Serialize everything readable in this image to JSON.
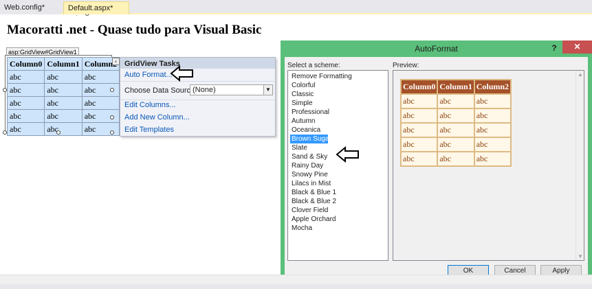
{
  "tabs": [
    {
      "label": "Web.config*"
    },
    {
      "label": "Default.aspx*",
      "pin_icon": "pin-icon",
      "close_icon": "close-icon"
    }
  ],
  "page": {
    "title": "Macoratti .net - Quase tudo para Visual Basic"
  },
  "gridview": {
    "tag": "asp:GridView#GridView1",
    "columns": [
      "Column0",
      "Column1",
      "Column2"
    ],
    "rows": [
      [
        "abc",
        "abc",
        "abc"
      ],
      [
        "abc",
        "abc",
        "abc"
      ],
      [
        "abc",
        "abc",
        "abc"
      ],
      [
        "abc",
        "abc",
        "abc"
      ],
      [
        "abc",
        "abc",
        "abc"
      ]
    ],
    "smart_tag_glyph": "‹"
  },
  "tasks": {
    "title": "GridView Tasks",
    "auto_format": "Auto Format...",
    "data_source_label": "Choose Data Source:",
    "data_source_value": "(None)",
    "edit_columns": "Edit Columns...",
    "add_column": "Add New Column...",
    "edit_templates": "Edit Templates"
  },
  "dialog": {
    "title": "AutoFormat",
    "help": "?",
    "close": "✕",
    "scheme_label": "Select a scheme:",
    "preview_label": "Preview:",
    "selected_scheme": "Brown Sugar",
    "schemes": [
      "Remove Formatting",
      "Colorful",
      "Classic",
      "Simple",
      "Professional",
      "Autumn",
      "Oceanica",
      "Brown Sugar",
      "Slate",
      "Sand & Sky",
      "Rainy Day",
      "Snowy Pine",
      "Lilacs in Mist",
      "Black & Blue 1",
      "Black & Blue 2",
      "Clover Field",
      "Apple Orchard",
      "Mocha"
    ],
    "preview": {
      "columns": [
        "Column0",
        "Column1",
        "Column2"
      ],
      "rows": [
        [
          "abc",
          "abc",
          "abc"
        ],
        [
          "abc",
          "abc",
          "abc"
        ],
        [
          "abc",
          "abc",
          "abc"
        ],
        [
          "abc",
          "abc",
          "abc"
        ],
        [
          "abc",
          "abc",
          "abc"
        ]
      ]
    },
    "buttons": {
      "ok": "OK",
      "cancel": "Cancel",
      "apply": "Apply"
    }
  },
  "colors": {
    "dialog_frame": "#5abf7a",
    "close_button": "#c75050",
    "selection": "#3399ff",
    "brown_header": "#a55129",
    "brown_cell_text": "#8c4510",
    "link": "#0a57b8"
  }
}
